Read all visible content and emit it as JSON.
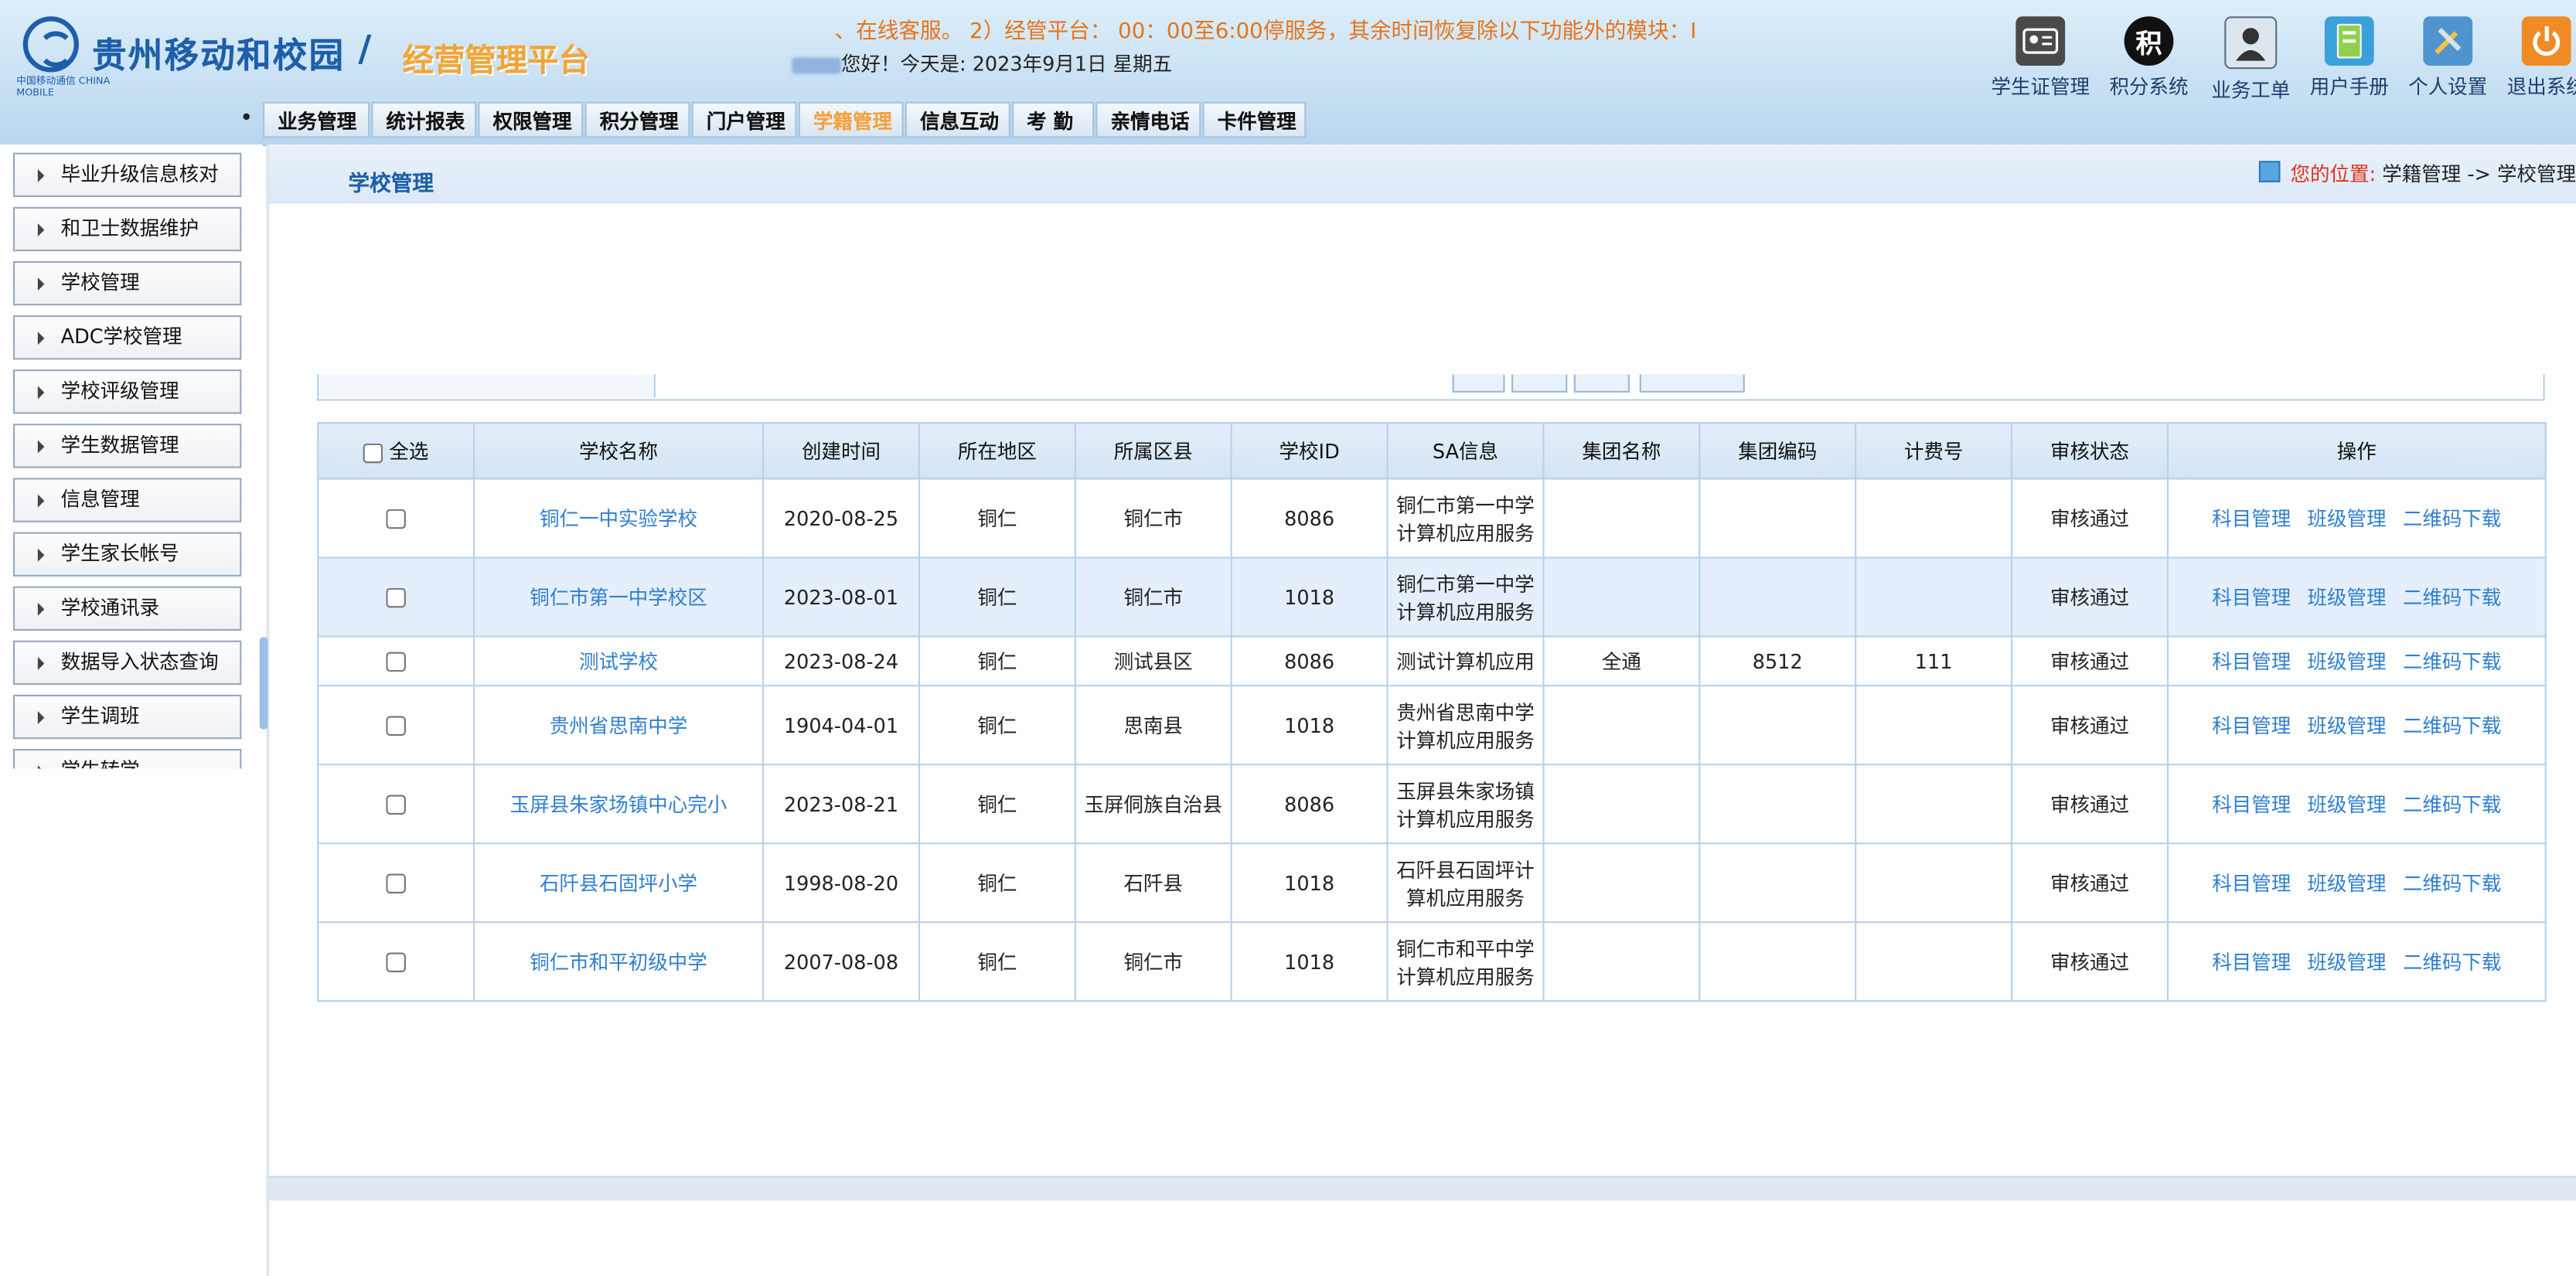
{
  "header": {
    "brand": "贵州移动和校园",
    "brand_sub": "中国移动通信 CHINA MOBILE",
    "separator": "/",
    "platform": "经营管理平台",
    "marquee": "、在线客服。 2）经管平台： 00：00至6:00停服务，其余时间恢复除以下功能外的模块：I",
    "greeting": "您好！今天是: 2023年9月1日   星期五",
    "icons": [
      {
        "label": "学生证管理",
        "icon": "id-card-icon",
        "color": "#4a4a4a"
      },
      {
        "label": "积分系统",
        "icon": "points-icon",
        "glyph": "积",
        "color": "#111111"
      },
      {
        "label": "业务工单",
        "icon": "agent-icon",
        "color": "#5a6f86"
      },
      {
        "label": "用户手册",
        "icon": "manual-icon",
        "color": "#3aa0d8"
      },
      {
        "label": "个人设置",
        "icon": "tools-icon",
        "color": "#4f94cf"
      },
      {
        "label": "退出系统",
        "icon": "power-icon",
        "color": "#f08a24"
      }
    ]
  },
  "nav": {
    "items": [
      "业务管理•",
      "统计报表•",
      "权限管理•",
      "积分管理•",
      "门户管理•",
      "学籍管理•",
      "信息互动•",
      "考 勤 •",
      "亲情电话•",
      "卡件管理"
    ],
    "active_index": 5
  },
  "sidebar": {
    "items": [
      "毕业升级信息核对",
      "和卫士数据维护",
      "学校管理",
      "ADC学校管理",
      "学校评级管理",
      "学生数据管理",
      "信息管理",
      "学生家长帐号",
      "学校通讯录",
      "数据导入状态查询",
      "学生调班",
      "学生转学"
    ]
  },
  "page": {
    "title": "学校管理",
    "location_label": "您的位置:",
    "location_path": "学籍管理 -> 学校管理"
  },
  "table": {
    "select_all_label": "全选",
    "columns": [
      "学校名称",
      "创建时间",
      "所在地区",
      "所属区县",
      "学校ID",
      "SA信息",
      "集团名称",
      "集团编码",
      "计费号",
      "审核状态",
      "操作"
    ],
    "actions": [
      "科目管理",
      "班级管理",
      "二维码下载"
    ],
    "rows": [
      {
        "name": "铜仁一中实验学校",
        "created": "2020-08-25",
        "region": "铜仁",
        "county": "铜仁市",
        "school_id": "8086",
        "sa": "铜仁市第一中学计算机应用服务",
        "group": "",
        "group_code": "",
        "billing": "",
        "status": "审核通过"
      },
      {
        "name": "铜仁市第一中学校区",
        "created": "2023-08-01",
        "region": "铜仁",
        "county": "铜仁市",
        "school_id": "1018",
        "sa": "铜仁市第一中学计算机应用服务",
        "group": "",
        "group_code": "",
        "billing": "",
        "status": "审核通过"
      },
      {
        "name": "测试学校",
        "created": "2023-08-24",
        "region": "铜仁",
        "county": "测试县区",
        "school_id": "8086",
        "sa": "测试计算机应用",
        "group": "全通",
        "group_code": "8512",
        "billing": "111",
        "status": "审核通过"
      },
      {
        "name": "贵州省思南中学",
        "created": "1904-04-01",
        "region": "铜仁",
        "county": "思南县",
        "school_id": "1018",
        "sa": "贵州省思南中学计算机应用服务",
        "group": "",
        "group_code": "",
        "billing": "",
        "status": "审核通过"
      },
      {
        "name": "玉屏县朱家场镇中心完小",
        "created": "2023-08-21",
        "region": "铜仁",
        "county": "玉屏侗族自治县",
        "school_id": "8086",
        "sa": "玉屏县朱家场镇计算机应用服务",
        "group": "",
        "group_code": "",
        "billing": "",
        "status": "审核通过"
      },
      {
        "name": "石阡县石固坪小学",
        "created": "1998-08-20",
        "region": "铜仁",
        "county": "石阡县",
        "school_id": "1018",
        "sa": "石阡县石固坪计算机应用服务",
        "group": "",
        "group_code": "",
        "billing": "",
        "status": "审核通过"
      },
      {
        "name": "铜仁市和平初级中学",
        "created": "2007-08-08",
        "region": "铜仁",
        "county": "铜仁市",
        "school_id": "1018",
        "sa": "铜仁市和平中学计算机应用服务",
        "group": "",
        "group_code": "",
        "billing": "",
        "status": "审核通过"
      }
    ]
  }
}
